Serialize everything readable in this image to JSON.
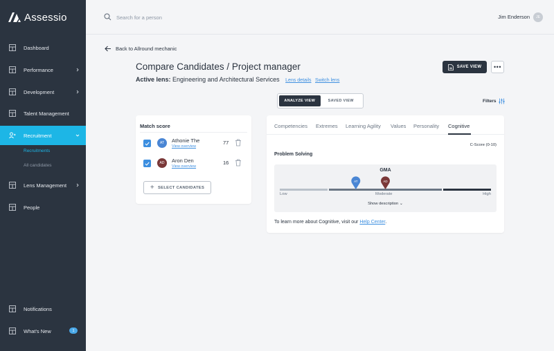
{
  "app": {
    "name": "Assessio"
  },
  "sidebar": {
    "items": [
      {
        "label": "Dashboard",
        "icon": "dashboard-icon"
      },
      {
        "label": "Performance",
        "icon": "performance-icon"
      },
      {
        "label": "Development",
        "icon": "development-icon"
      },
      {
        "label": "Talent Management",
        "icon": "talent-icon"
      },
      {
        "label": "Recruitment",
        "icon": "recruitment-icon"
      },
      {
        "label": "Lens Management",
        "icon": "lens-icon"
      },
      {
        "label": "People",
        "icon": "people-icon"
      }
    ],
    "sub_items": [
      {
        "label": "Recruitments"
      },
      {
        "label": "All candidates"
      }
    ],
    "bottom_items": [
      {
        "label": "Notifications",
        "icon": "bell-icon"
      },
      {
        "label": "What's New",
        "icon": "news-icon",
        "badge": "1"
      }
    ],
    "active_color": "#1db6e6",
    "bg_color": "#2b3440"
  },
  "topbar": {
    "search_placeholder": "Search for a person",
    "user_name": "Jim Enderson",
    "user_initials": "JE"
  },
  "main": {
    "back_label": "Back to Allround mechanic",
    "title": "Compare Candidates / Project manager",
    "lens_prefix": "Active lens:",
    "lens_name": "Engineering and Architectural Services",
    "lens_details": "Lens details",
    "switch_lens": "Switch lens",
    "save_view": "SAVE VIEW",
    "more": "•••",
    "view_toggle": {
      "analyze": "ANALYZE VIEW",
      "saved": "SAVED VIEW",
      "selected": "analyze"
    },
    "filters": "Filters"
  },
  "match_card": {
    "title": "Match score",
    "candidates": [
      {
        "initials": "AT",
        "name": "Athonie The",
        "link": "View overview",
        "score": "77",
        "color": "#4a86d4",
        "checked": true
      },
      {
        "initials": "AD",
        "name": "Aron Den",
        "link": "View overview",
        "score": "16",
        "color": "#7a3838",
        "checked": true
      }
    ],
    "select_button": "SELECT CANDIDATES"
  },
  "detail_card": {
    "tabs": [
      "Competencies",
      "Extremes",
      "Learning Agility",
      "Values",
      "Personality",
      "Cognitive"
    ],
    "active_tab": "Cognitive",
    "score_label": "C-Score (0-10)",
    "section_title": "Problem Solving",
    "gma": {
      "title": "GMA",
      "low": "Low",
      "moderate": "Moderate",
      "high": "High",
      "show_description": "Show description",
      "markers": [
        {
          "initials": "AT",
          "level": 0.36,
          "color": "#4a86d4"
        },
        {
          "initials": "AD",
          "level": 0.5,
          "color": "#7a3838"
        }
      ]
    },
    "help_prefix": "To learn more about Cognitive, visit our",
    "help_link": "Help Center",
    "help_suffix": "."
  }
}
